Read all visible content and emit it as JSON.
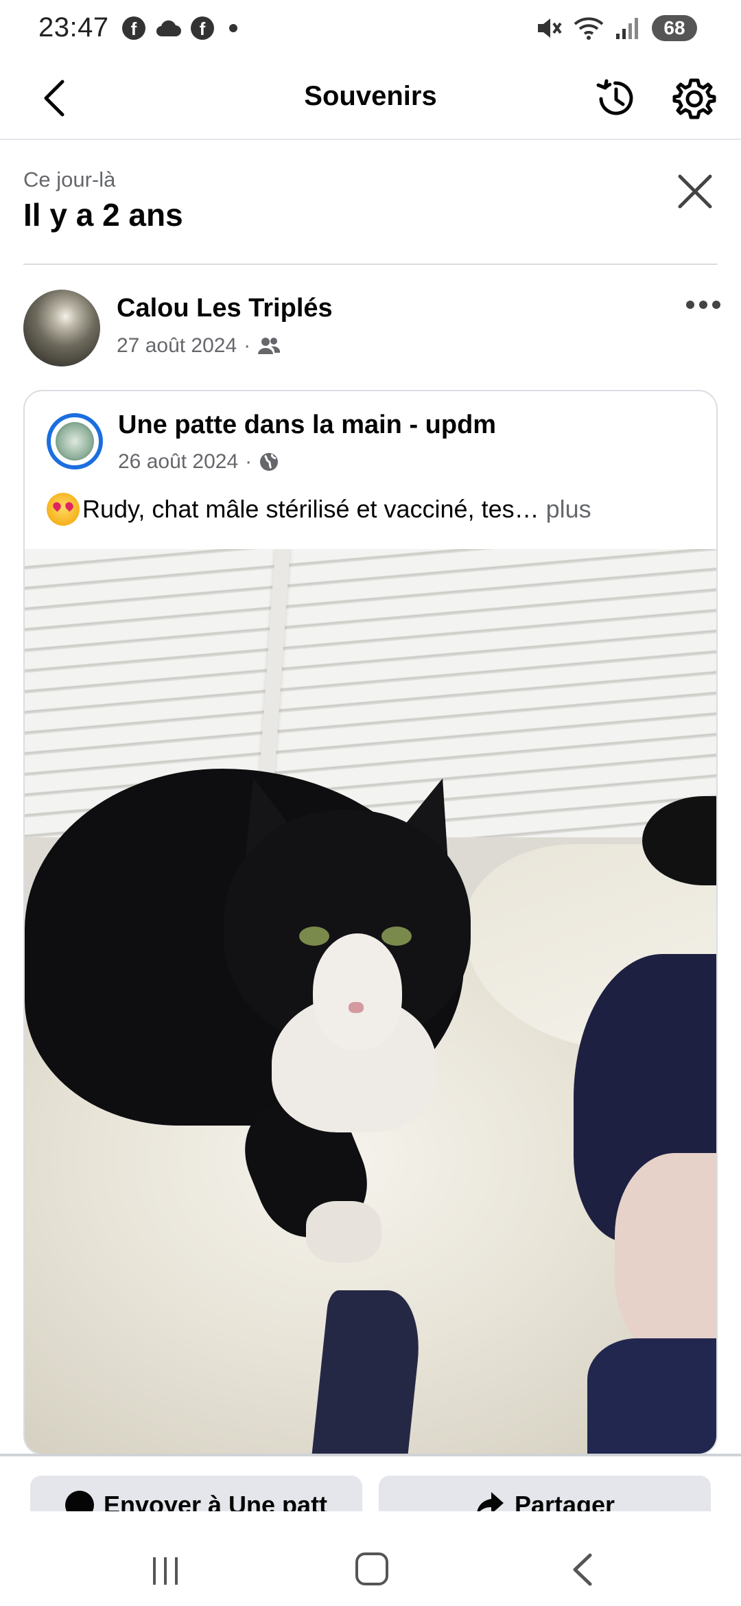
{
  "status_bar": {
    "time": "23:47",
    "left_icons": [
      "facebook-icon",
      "cloud-icon",
      "facebook-icon",
      "dot-icon"
    ],
    "right_icons": [
      "mute-icon",
      "wifi-icon",
      "signal-icon"
    ],
    "battery": "68"
  },
  "header": {
    "title": "Souvenirs",
    "back_icon": "chevron-left-icon",
    "history_icon": "history-icon",
    "settings_icon": "gear-icon"
  },
  "memory": {
    "subtitle": "Ce jour-là",
    "title": "Il y a 2 ans",
    "close_icon": "close-icon"
  },
  "post": {
    "author_name": "Calou Les Triplés",
    "date": "27 août 2024",
    "audience_icon": "friends-icon",
    "more_icon": "more-icon"
  },
  "shared_post": {
    "page_name": "Une patte dans la main - updm",
    "date": "26 août 2024",
    "audience_icon": "globe-icon",
    "text": "Rudy, chat mâle stérilisé et vacciné, tes…",
    "see_more": "plus",
    "emoji": "heart-eyes-cat-emoji"
  },
  "actions": {
    "send_label": "Envoyer à Une patt",
    "share_label": "Partager"
  },
  "nav_bar": {
    "items": [
      "recent-apps",
      "home",
      "back"
    ]
  },
  "colors": {
    "accent": "#1b6ee0",
    "secondary_text": "#65676b",
    "button_bg": "#e4e6eb"
  }
}
